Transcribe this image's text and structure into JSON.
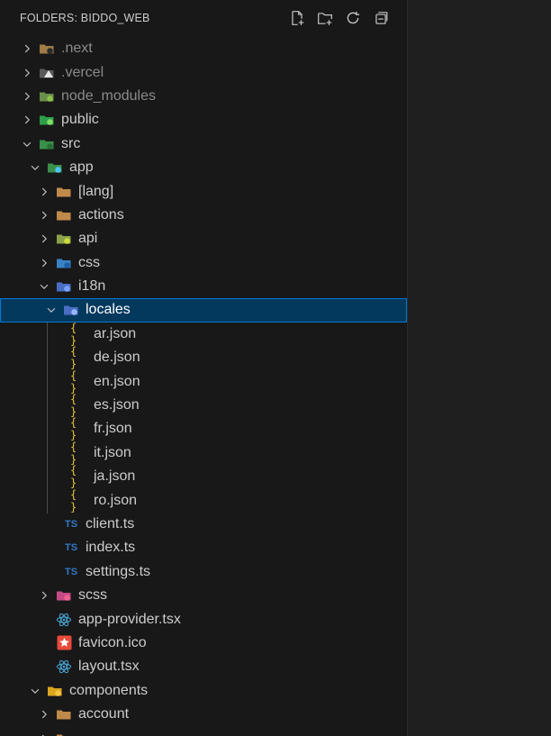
{
  "header": {
    "title": "FOLDERS: BIDDO_WEB",
    "actions": [
      "new-file-icon",
      "new-folder-icon",
      "refresh-icon",
      "collapse-all-icon"
    ]
  },
  "tree": [
    {
      "label": ".next",
      "depth": 0,
      "state": "collapsed",
      "icon": "next-folder-icon",
      "dim": true
    },
    {
      "label": ".vercel",
      "depth": 0,
      "state": "collapsed",
      "icon": "vercel-folder-icon",
      "dim": true
    },
    {
      "label": "node_modules",
      "depth": 0,
      "state": "collapsed",
      "icon": "node-folder-icon",
      "dim": true
    },
    {
      "label": "public",
      "depth": 0,
      "state": "collapsed",
      "icon": "public-folder-icon"
    },
    {
      "label": "src",
      "depth": 0,
      "state": "expanded",
      "icon": "src-folder-icon"
    },
    {
      "label": "app",
      "depth": 1,
      "state": "expanded",
      "icon": "app-folder-icon"
    },
    {
      "label": "[lang]",
      "depth": 2,
      "state": "collapsed",
      "icon": "folder-icon"
    },
    {
      "label": "actions",
      "depth": 2,
      "state": "collapsed",
      "icon": "folder-icon"
    },
    {
      "label": "api",
      "depth": 2,
      "state": "collapsed",
      "icon": "api-folder-icon"
    },
    {
      "label": "css",
      "depth": 2,
      "state": "collapsed",
      "icon": "css-folder-icon"
    },
    {
      "label": "i18n",
      "depth": 2,
      "state": "expanded",
      "icon": "i18n-folder-icon"
    },
    {
      "label": "locales",
      "depth": 3,
      "state": "expanded",
      "icon": "locales-folder-icon",
      "selected": true
    },
    {
      "label": "ar.json",
      "depth": 4,
      "state": "file",
      "icon": "json-icon"
    },
    {
      "label": "de.json",
      "depth": 4,
      "state": "file",
      "icon": "json-icon"
    },
    {
      "label": "en.json",
      "depth": 4,
      "state": "file",
      "icon": "json-icon"
    },
    {
      "label": "es.json",
      "depth": 4,
      "state": "file",
      "icon": "json-icon"
    },
    {
      "label": "fr.json",
      "depth": 4,
      "state": "file",
      "icon": "json-icon"
    },
    {
      "label": "it.json",
      "depth": 4,
      "state": "file",
      "icon": "json-icon"
    },
    {
      "label": "ja.json",
      "depth": 4,
      "state": "file",
      "icon": "json-icon"
    },
    {
      "label": "ro.json",
      "depth": 4,
      "state": "file",
      "icon": "json-icon"
    },
    {
      "label": "client.ts",
      "depth": 3,
      "state": "file",
      "icon": "typescript-icon"
    },
    {
      "label": "index.ts",
      "depth": 3,
      "state": "file",
      "icon": "typescript-icon"
    },
    {
      "label": "settings.ts",
      "depth": 3,
      "state": "file",
      "icon": "typescript-icon"
    },
    {
      "label": "scss",
      "depth": 2,
      "state": "collapsed",
      "icon": "scss-folder-icon"
    },
    {
      "label": "app-provider.tsx",
      "depth": 2,
      "state": "file",
      "icon": "react-icon"
    },
    {
      "label": "favicon.ico",
      "depth": 2,
      "state": "file",
      "icon": "favicon-icon"
    },
    {
      "label": "layout.tsx",
      "depth": 2,
      "state": "file",
      "icon": "react-icon"
    },
    {
      "label": "components",
      "depth": 1,
      "state": "expanded",
      "icon": "components-folder-icon"
    },
    {
      "label": "account",
      "depth": 2,
      "state": "collapsed",
      "icon": "folder-icon"
    },
    {
      "label": "",
      "depth": 2,
      "state": "collapsed",
      "icon": "folder-icon"
    }
  ]
}
